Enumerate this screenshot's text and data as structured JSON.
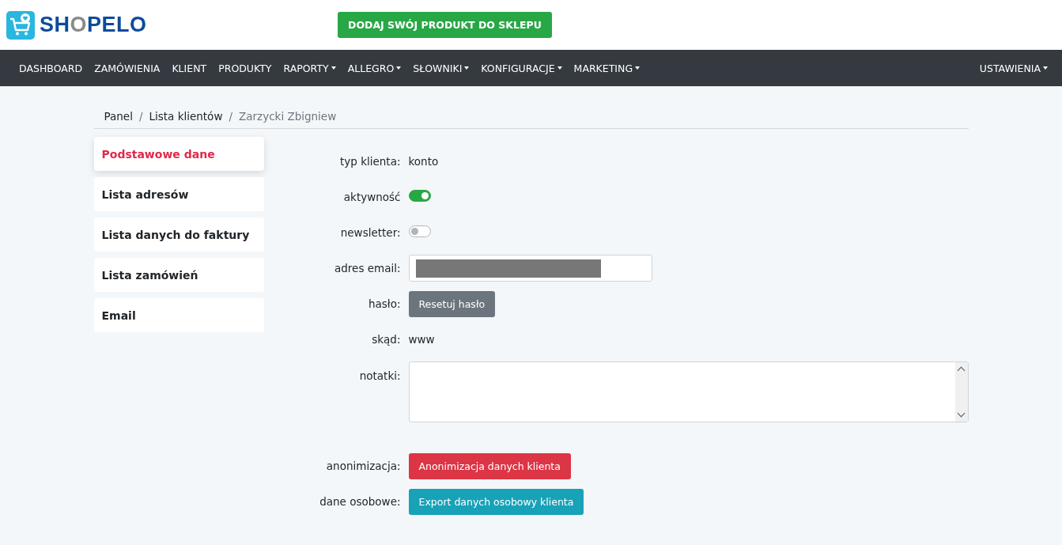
{
  "logo": {
    "parts": [
      {
        "text": "SH",
        "accent": false
      },
      {
        "text": "O",
        "accent": true
      },
      {
        "text": "PELO",
        "accent": false
      }
    ]
  },
  "header_button": "DODAJ SWÓJ PRODUKT DO SKLEPU",
  "nav": {
    "items": [
      {
        "label": "DASHBOARD",
        "dropdown": false
      },
      {
        "label": "ZAMÓWIENIA",
        "dropdown": false
      },
      {
        "label": "KLIENT",
        "dropdown": false
      },
      {
        "label": "PRODUKTY",
        "dropdown": false
      },
      {
        "label": "RAPORTY",
        "dropdown": true
      },
      {
        "label": "ALLEGRO",
        "dropdown": true
      },
      {
        "label": "SŁOWNIKI",
        "dropdown": true
      },
      {
        "label": "KONFIGURACJE",
        "dropdown": true
      },
      {
        "label": "MARKETING",
        "dropdown": true
      }
    ],
    "right": {
      "label": "USTAWIENIA",
      "dropdown": true
    }
  },
  "breadcrumb": [
    {
      "kind": "link",
      "label": "Panel",
      "current": false
    },
    {
      "kind": "separator",
      "label": "/"
    },
    {
      "kind": "link",
      "label": "Lista klientów",
      "current": false
    },
    {
      "kind": "separator",
      "label": "/"
    },
    {
      "kind": "link",
      "label": "Zarzycki Zbigniew",
      "current": true
    }
  ],
  "sidebar": {
    "items": [
      {
        "label": "Podstawowe dane",
        "selected": true
      },
      {
        "label": "Lista adresów",
        "selected": false
      },
      {
        "label": "Lista danych do faktury",
        "selected": false
      },
      {
        "label": "Lista zamówień",
        "selected": false
      },
      {
        "label": "Email",
        "selected": false
      }
    ]
  },
  "form": [
    {
      "kind": "text",
      "label": "typ klienta:",
      "value": "konto"
    },
    {
      "kind": "toggle",
      "label": "aktywność",
      "on": true
    },
    {
      "kind": "toggle",
      "label": "newsletter:",
      "on": false
    },
    {
      "kind": "email",
      "label": "adres email:",
      "redacted": true
    },
    {
      "kind": "button",
      "label": "hasło:",
      "button": "Resetuj hasło"
    },
    {
      "kind": "text",
      "label": "skąd:",
      "value": "www"
    },
    {
      "kind": "textarea",
      "label": "notatki:"
    },
    {
      "kind": "button",
      "label": "anonimizacja:",
      "button": "Anonimizacja danych klienta"
    },
    {
      "kind": "button",
      "label": "dane osobowe:",
      "button": "Export danych osobowy klienta"
    }
  ]
}
